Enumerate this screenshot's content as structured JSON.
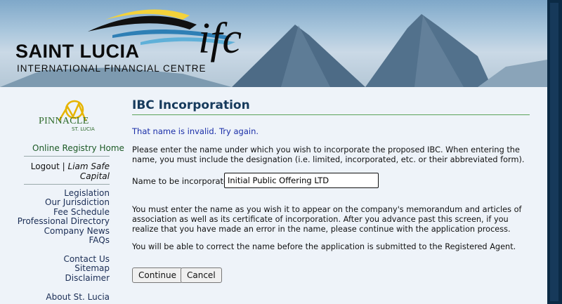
{
  "banner": {
    "brand_main": "SAINT LUCIA",
    "brand_sub": "INTERNATIONAL FINANCIAL CENTRE",
    "brand_ifc": "ifc"
  },
  "sidebar": {
    "logo_main": "PINNACLE",
    "logo_sub": "ST. LUCIA",
    "home": "Online Registry Home",
    "logout": "Logout",
    "separator": "|",
    "user": "Liam Safe Capital",
    "links_group1": [
      "Legislation",
      "Our Jurisdiction",
      "Fee Schedule",
      "Professional Directory",
      "Company News",
      "FAQs"
    ],
    "links_group2": [
      "Contact Us",
      "Sitemap",
      "Disclaimer"
    ],
    "links_group3": [
      "About St. Lucia"
    ]
  },
  "main": {
    "title": "IBC Incorporation",
    "error": "That name is invalid. Try again.",
    "instructions": "Please enter the name under which you wish to incorporate the proposed IBC. When entering the name, you must include the designation (i.e. limited, incorporated, etc. or their abbreviated form).",
    "name_label": "Name to be incorporated:",
    "name_value": "Initial Public Offering LTD",
    "notice": "You must enter the name as you wish it to appear on the company's memorandum and articles of association as well as its certificate of incorporation. After you advance past this screen, if you realize that you have made an error in the name, please continue with the application process.",
    "notice2": "You will be able to correct the name before the application is submitted to the Registered Agent.",
    "continue_label": "Continue",
    "cancel_label": "Cancel"
  },
  "colors": {
    "title": "#163a5c",
    "error": "#1a2ea8",
    "rule": "#5aa35a",
    "nav_home": "#1c5a25",
    "background": "#eef3f9"
  },
  "icons": [
    "swoosh-logo-icon",
    "pinnacle-logo-icon"
  ]
}
